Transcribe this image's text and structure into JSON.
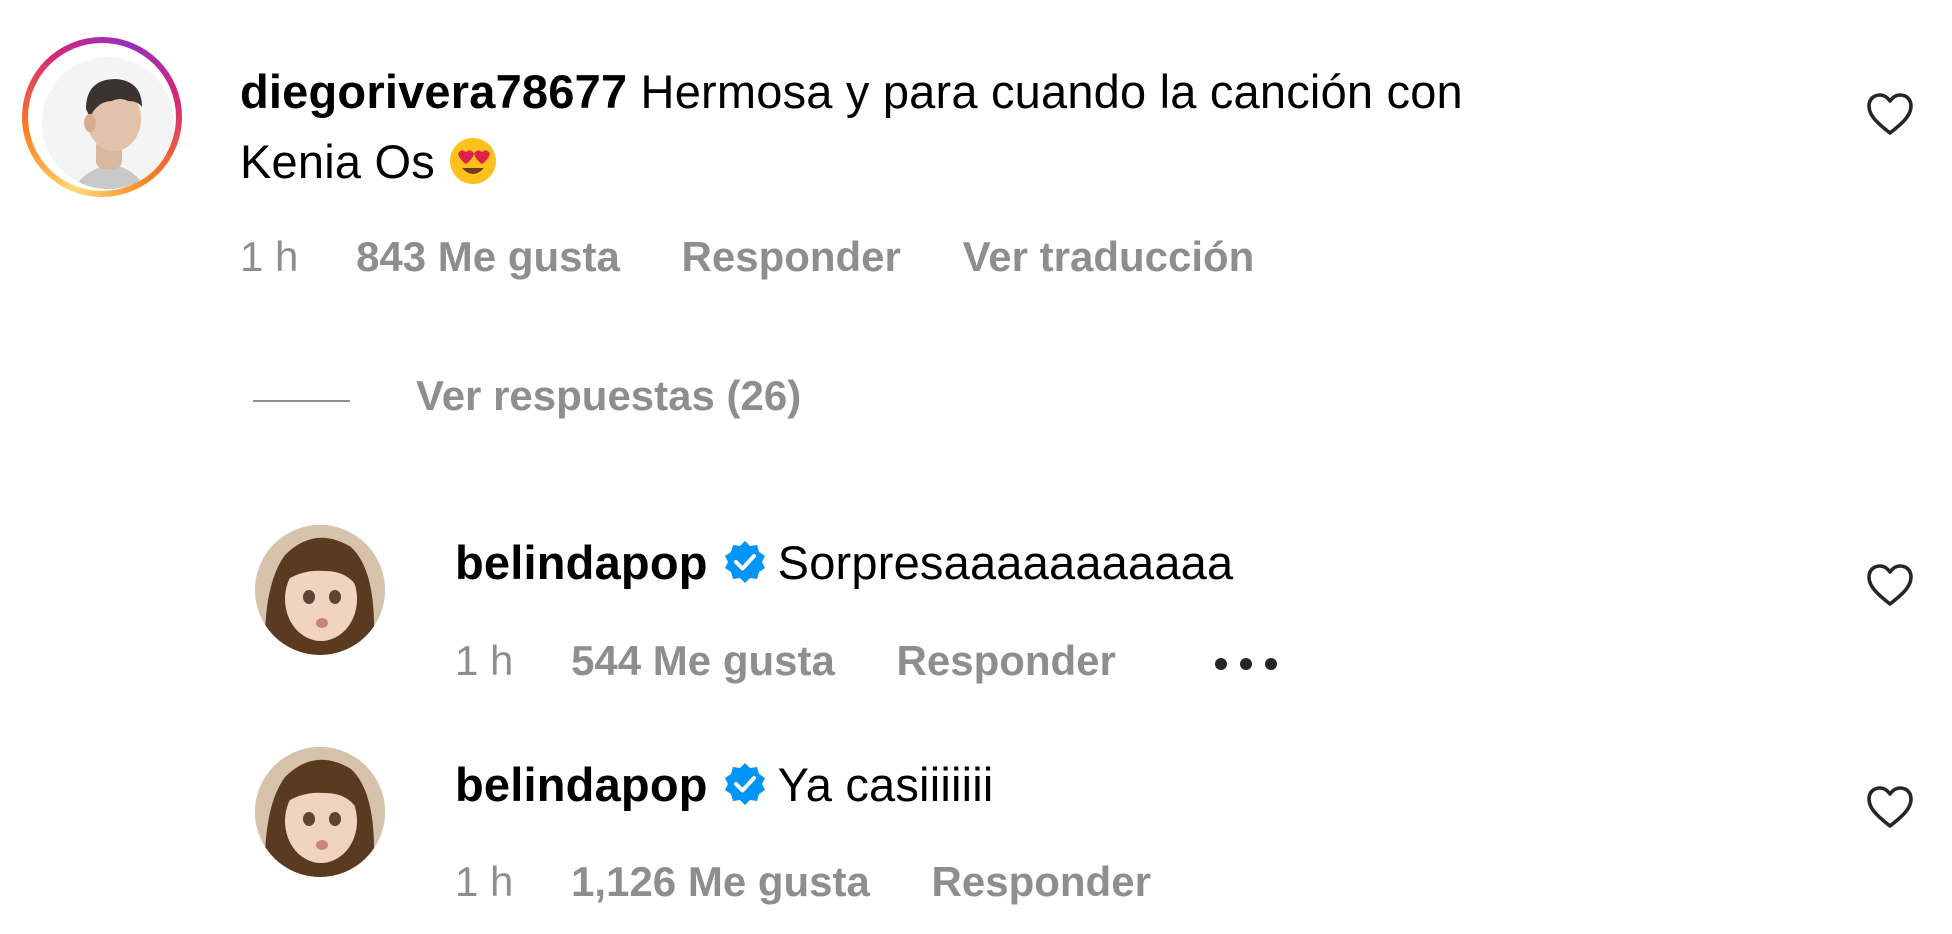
{
  "comment": {
    "username": "diegorivera78677",
    "text": "Hermosa y para cuando la canción con",
    "text_line2": "Kenia Os",
    "emoji": "smiling-face-with-heart-eyes",
    "time": "1 h",
    "likes": "843 Me gusta",
    "reply_label": "Responder",
    "translate_label": "Ver traducción",
    "avatar_icon": "profile-photo",
    "story_ring_colors": [
      "#feda75",
      "#fa7e1e",
      "#d62976",
      "#962fbf"
    ]
  },
  "view_replies": {
    "label": "Ver respuestas (26)"
  },
  "replies": [
    {
      "username": "belindapop",
      "verified": true,
      "text": "Sorpresaaaaaaaaaaa",
      "time": "1 h",
      "likes": "544 Me gusta",
      "reply_label": "Responder",
      "more_icon": "more-options-icon"
    },
    {
      "username": "belindapop",
      "verified": true,
      "text": "Ya casiiiiiii",
      "time": "1 h",
      "likes": "1,126 Me gusta",
      "reply_label": "Responder"
    }
  ],
  "colors": {
    "meta_gray": "#8e8e8e",
    "verified_blue": "#0095f6",
    "text": "#000000"
  }
}
